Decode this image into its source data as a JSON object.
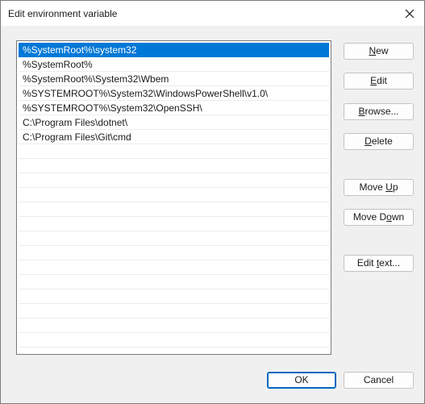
{
  "window": {
    "title": "Edit environment variable"
  },
  "paths": {
    "items": [
      "%SystemRoot%\\system32",
      "%SystemRoot%",
      "%SystemRoot%\\System32\\Wbem",
      "%SYSTEMROOT%\\System32\\WindowsPowerShell\\v1.0\\",
      "%SYSTEMROOT%\\System32\\OpenSSH\\",
      "C:\\Program Files\\dotnet\\",
      "C:\\Program Files\\Git\\cmd"
    ],
    "selected_index": 0,
    "empty_rows": 14
  },
  "buttons": {
    "new": {
      "before": "",
      "mnemonic": "N",
      "after": "ew"
    },
    "edit": {
      "before": "",
      "mnemonic": "E",
      "after": "dit"
    },
    "browse": {
      "before": "",
      "mnemonic": "B",
      "after": "rowse..."
    },
    "delete": {
      "before": "",
      "mnemonic": "D",
      "after": "elete"
    },
    "move_up": {
      "before": "Move ",
      "mnemonic": "U",
      "after": "p"
    },
    "move_down": {
      "before": "Move D",
      "mnemonic": "o",
      "after": "wn"
    },
    "edit_text": {
      "before": "Edit ",
      "mnemonic": "t",
      "after": "ext..."
    },
    "ok": "OK",
    "cancel": "Cancel"
  },
  "colors": {
    "selection": "#0078d7",
    "default_button_border": "#0067c0"
  },
  "icons": {
    "close": "close-icon"
  }
}
